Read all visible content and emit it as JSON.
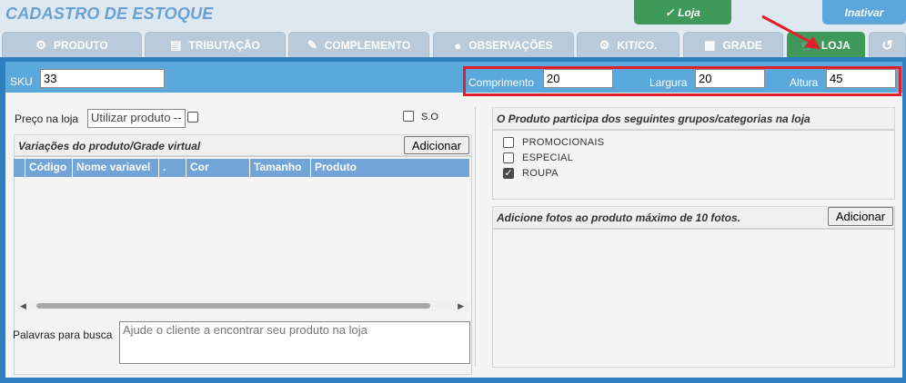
{
  "app": {
    "title": "CADASTRO DE ESTOQUE"
  },
  "top_buttons": {
    "loja": "Loja",
    "loja_check": "✓",
    "inativar": "Inativar"
  },
  "tabs": [
    {
      "label": "PRODUTO",
      "icon": "⚙"
    },
    {
      "label": "TRIBUTAÇÃO",
      "icon": "▤"
    },
    {
      "label": "COMPLEMENTO",
      "icon": "✎"
    },
    {
      "label": "OBSERVAÇÕES",
      "icon": "●"
    },
    {
      "label": "KIT/CO.",
      "icon": "⚙"
    },
    {
      "label": "GRADE",
      "icon": "▦"
    },
    {
      "label": "LOJA",
      "icon": "🛒"
    },
    {
      "label": "",
      "icon": "↺"
    }
  ],
  "sku": {
    "label": "SKU",
    "value": "33"
  },
  "dims": {
    "comprimento_label": "Comprimento",
    "comprimento": "20",
    "largura_label": "Largura",
    "largura": "20",
    "altura_label": "Altura",
    "altura": "45"
  },
  "left": {
    "preco_label": "Preço na loja",
    "preco_select": "Utilizar produto --",
    "so_label": "S.O",
    "variacoes_title": "Variações do produto/Grade virtual",
    "add_button": "Adicionar",
    "columns": [
      "Código",
      "Nome variavel",
      ".",
      "Cor",
      "Tamanho",
      "Produto"
    ],
    "palavras_label": "Palavras para busca",
    "palavras_placeholder": "Ajude o cliente a encontrar seu produto na loja"
  },
  "right": {
    "groups_title": "O Produto participa dos seguintes grupos/categorias na loja",
    "categories": [
      {
        "label": "PROMOCIONAIS",
        "checked": false
      },
      {
        "label": "ESPECIAL",
        "checked": false
      },
      {
        "label": "ROUPA",
        "checked": true
      }
    ],
    "photos_title": "Adicione fotos ao produto máximo de 10 fotos.",
    "photos_add": "Adicionar"
  },
  "colors": {
    "accent_green": "#3f9a5a",
    "accent_blue": "#2d7fc0",
    "highlight_red": "#e0202a"
  }
}
